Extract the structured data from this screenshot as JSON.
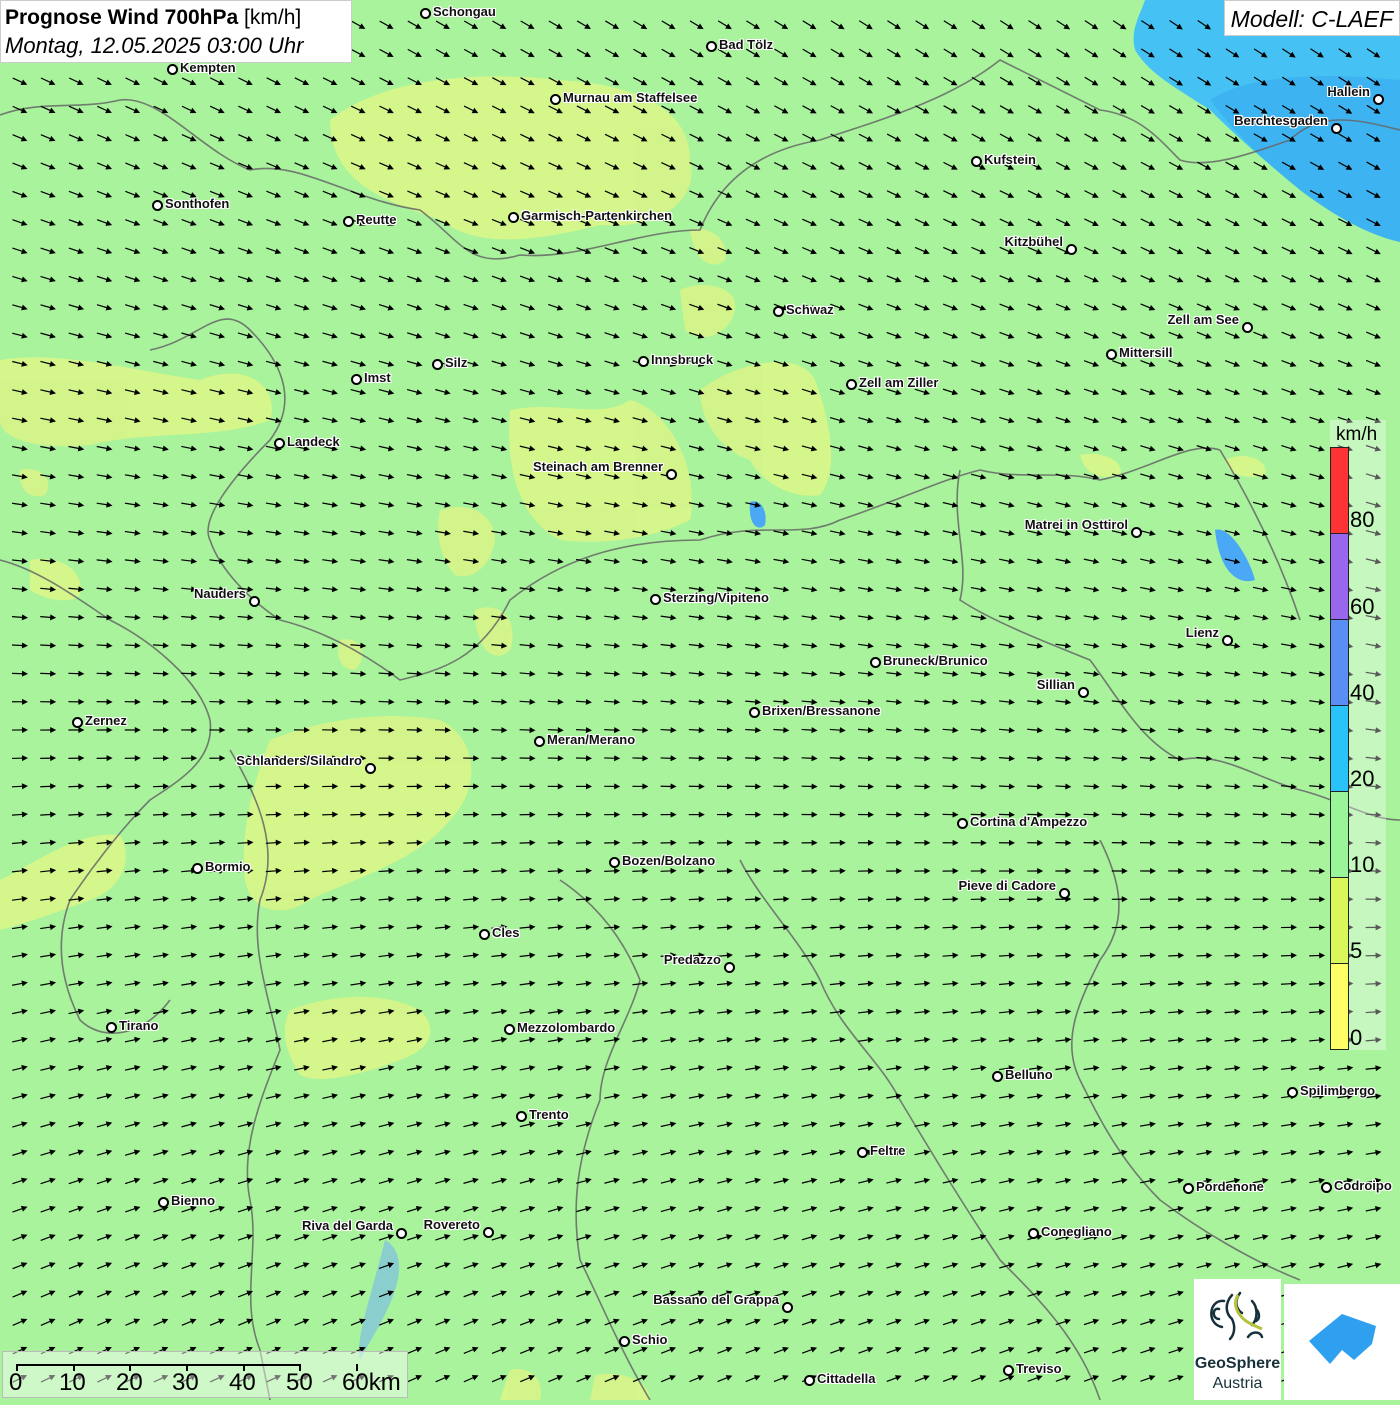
{
  "header": {
    "title_bold": "Prognose Wind 700hPa",
    "title_unit": "[km/h]",
    "datetime": "Montag, 12.05.2025 03:00 Uhr",
    "model": "Modell: C-LAEF"
  },
  "legend": {
    "unit": "km/h",
    "ticks": [
      "80",
      "60",
      "40",
      "20",
      "10",
      "5",
      "0"
    ],
    "colors": [
      "#ff3333",
      "#9966ee",
      "#5b8ef5",
      "#29c3fa",
      "#9af59a",
      "#d9f75a",
      "#ffff66"
    ]
  },
  "scale_bar": {
    "labels": [
      "0",
      "10",
      "20",
      "30",
      "40",
      "50",
      "60km"
    ]
  },
  "logos": {
    "geosphere_line1": "GeoSphere",
    "geosphere_line2": "Austria"
  },
  "cities": [
    "Schongau",
    "Bad Tölz",
    "Kempten",
    "Murnau am Staffelsee",
    "Hallein",
    "Berchtesgaden",
    "Kufstein",
    "Sonthofen",
    "Reutte",
    "Garmisch-Partenkirchen",
    "Kitzbühel",
    "Schwaz",
    "Zell am See",
    "Mittersill",
    "Innsbruck",
    "Silz",
    "Imst",
    "Zell am Ziller",
    "Landeck",
    "Steinach am Brenner",
    "Matrei in Osttirol",
    "Nauders",
    "Sterzing/Vipiteno",
    "Lienz",
    "Bruneck/Brunico",
    "Sillian",
    "Brixen/Bressanone",
    "Zernez",
    "Meran/Merano",
    "Schlanders/Silandro",
    "Cortina d'Ampezzo",
    "Bozen/Bolzano",
    "Bormio",
    "Pieve di Cadore",
    "Cles",
    "Predazzo",
    "Tirano",
    "Mezzolombardo",
    "Belluno",
    "Spilimbergo",
    "Trento",
    "Feltre",
    "Pordenone",
    "Codroipo",
    "Bienno",
    "Riva del Garda",
    "Rovereto",
    "Conegliano",
    "Bassano del Grappa",
    "Schio",
    "Treviso",
    "Cittadella"
  ]
}
